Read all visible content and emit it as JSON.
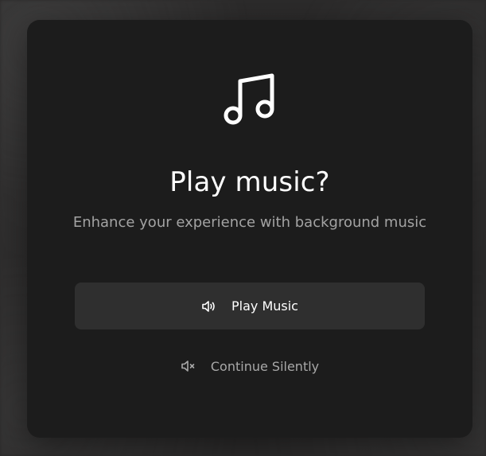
{
  "dialog": {
    "icon": "music-note-icon",
    "title": "Play music?",
    "subtitle": "Enhance your experience with background music",
    "primary_button": {
      "label": "Play Music",
      "icon": "speaker-icon"
    },
    "secondary_button": {
      "label": "Continue Silently",
      "icon": "speaker-muted-icon"
    }
  },
  "colors": {
    "modal_background": "#1c1c1c",
    "primary_button_background": "#2f2f2f",
    "title_text": "#ffffff",
    "muted_text": "#a3a3a3"
  }
}
